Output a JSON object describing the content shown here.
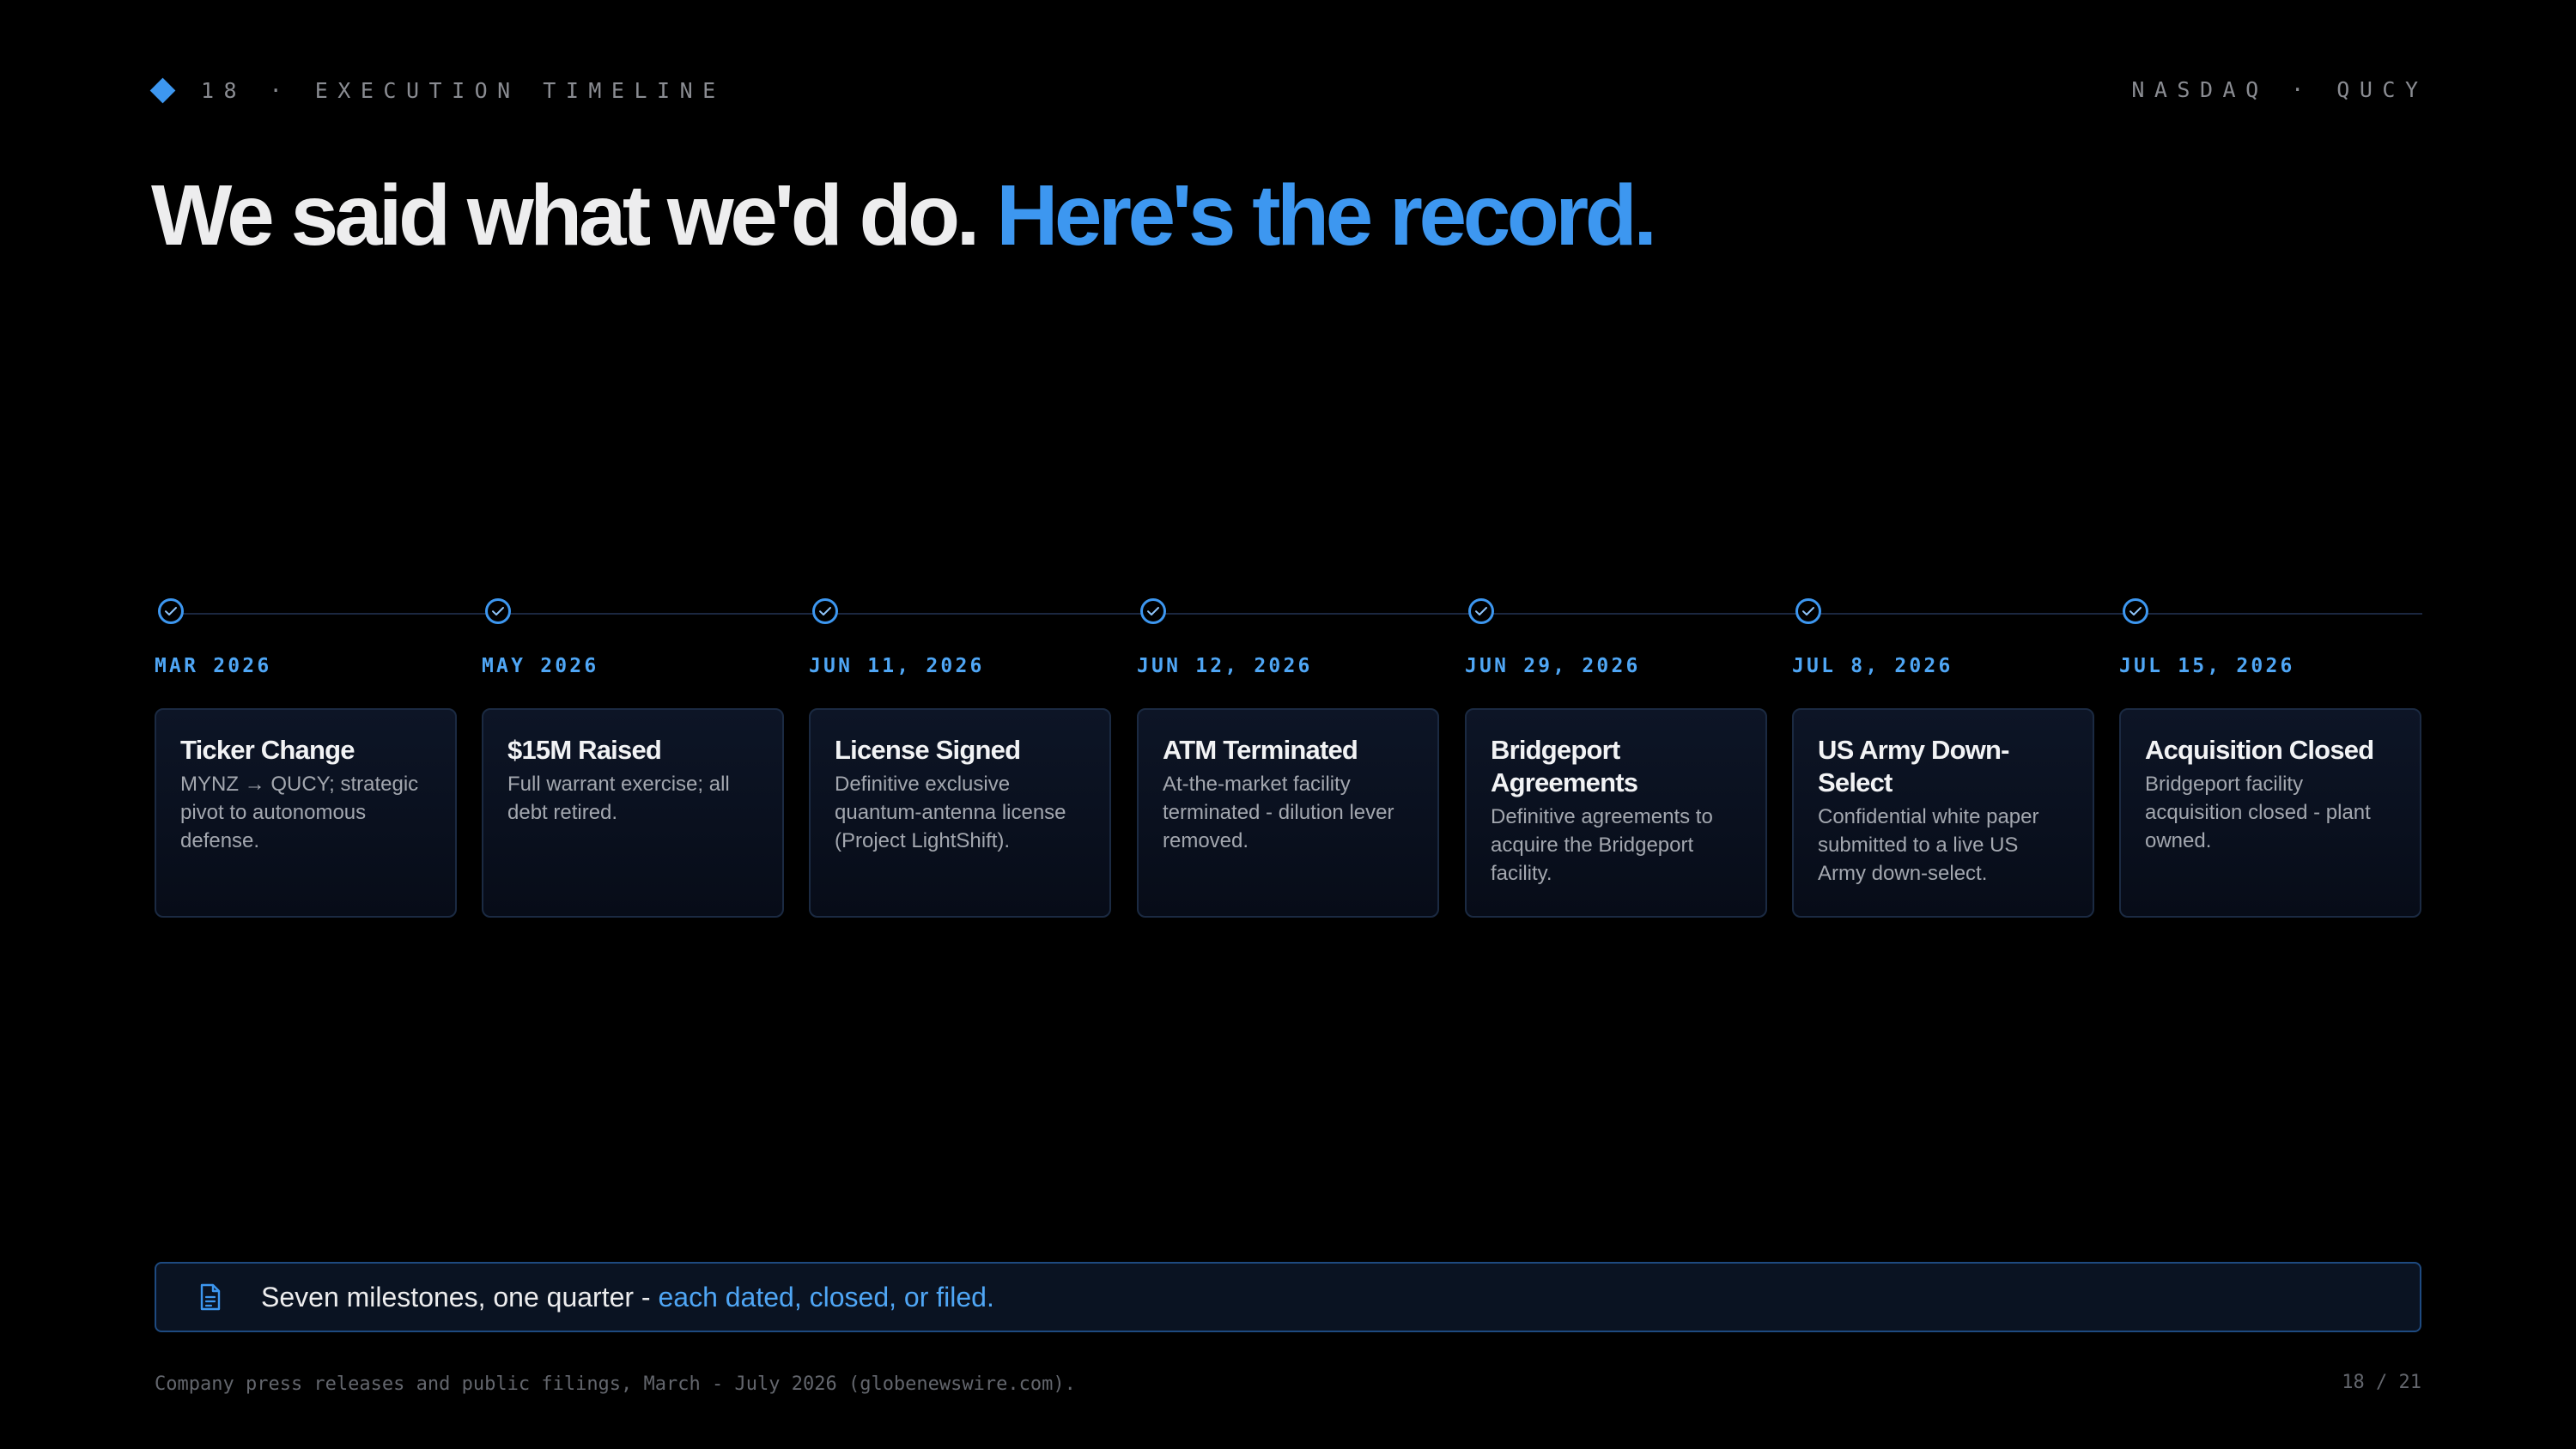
{
  "header": {
    "kicker": "18 · EXECUTION TIMELINE",
    "ticker": "NASDAQ · QUCY"
  },
  "headline": {
    "part1": "We said what we'd do.",
    "part2": "Here's the record."
  },
  "milestones": [
    {
      "date": "MAR 2026",
      "title": "Ticker Change",
      "desc": "MYNZ → QUCY; strategic pivot to autonomous defense."
    },
    {
      "date": "MAY 2026",
      "title": "$15M Raised",
      "desc": "Full warrant exercise; all debt retired."
    },
    {
      "date": "JUN 11, 2026",
      "title": "License Signed",
      "desc": "Definitive exclusive quantum-antenna license (Project LightShift)."
    },
    {
      "date": "JUN 12, 2026",
      "title": "ATM Terminated",
      "desc": "At-the-market facility terminated - dilution lever removed."
    },
    {
      "date": "JUN 29, 2026",
      "title": "Bridgeport Agreements",
      "desc": "Definitive agreements to acquire the Bridgeport facility."
    },
    {
      "date": "JUL 8, 2026",
      "title": "US Army Down-Select",
      "desc": "Confidential white paper submitted to a live US Army down-select."
    },
    {
      "date": "JUL 15, 2026",
      "title": "Acquisition Closed",
      "desc": "Bridgeport facility acquisition closed - plant owned."
    }
  ],
  "callout": {
    "text": "Seven milestones, one quarter - ",
    "accent": "each dated, closed, or filed.",
    "icon": "document-icon"
  },
  "footer": {
    "source": "Company press releases and public filings, March - July 2026 (globenewswire.com).",
    "page": "18 / 21"
  },
  "colors": {
    "background": "#000000",
    "accent": "#3d97f0",
    "text": "#ededee",
    "muted": "#8a8c92"
  }
}
